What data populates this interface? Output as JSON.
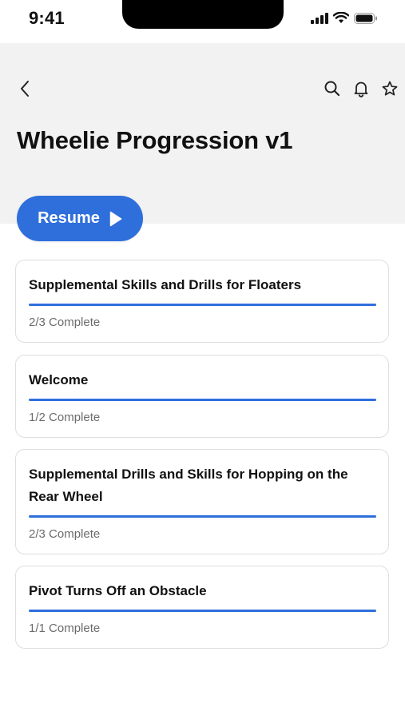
{
  "status_bar": {
    "time": "9:41"
  },
  "header": {
    "title": "Wheelie Progression v1",
    "icons": [
      "back-icon",
      "search-icon",
      "bell-icon",
      "star-icon"
    ]
  },
  "resume_button": {
    "label": "Resume",
    "icon": "play-icon"
  },
  "accent_color": "#2f6fdc",
  "sections": [
    {
      "title": "Supplemental Skills and Drills for Floaters",
      "status": "2/3 Complete",
      "progress": 1.0
    },
    {
      "title": "Welcome",
      "status": "1/2 Complete",
      "progress": 1.0
    },
    {
      "title": "Supplemental Drills and Skills for Hopping on the Rear Wheel",
      "status": "2/3 Complete",
      "progress": 1.0
    },
    {
      "title": "Pivot Turns Off an Obstacle",
      "status": "1/1 Complete",
      "progress": 1.0
    }
  ]
}
